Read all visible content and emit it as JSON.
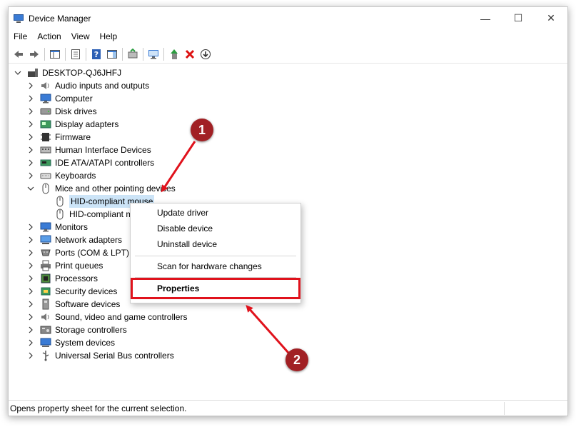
{
  "window": {
    "title": "Device Manager",
    "controls": {
      "minimize": "—",
      "maximize": "☐",
      "close": "✕"
    }
  },
  "menu": [
    "File",
    "Action",
    "View",
    "Help"
  ],
  "toolbar": [
    "back-icon",
    "forward-icon",
    "show-hide-console-tree-icon",
    "properties-icon",
    "help-icon",
    "action-pane-icon",
    "update-driver-icon",
    "scan-hardware-icon",
    "enable-device-icon",
    "uninstall-device-icon",
    "download-driver-icon"
  ],
  "tree": {
    "root": "DESKTOP-QJ6JHFJ",
    "categories": [
      {
        "label": "Audio inputs and outputs",
        "icon": "speaker-icon"
      },
      {
        "label": "Computer",
        "icon": "computer-icon"
      },
      {
        "label": "Disk drives",
        "icon": "disk-icon"
      },
      {
        "label": "Display adapters",
        "icon": "display-adapter-icon"
      },
      {
        "label": "Firmware",
        "icon": "firmware-icon"
      },
      {
        "label": "Human Interface Devices",
        "icon": "hid-icon"
      },
      {
        "label": "IDE ATA/ATAPI controllers",
        "icon": "ide-icon"
      },
      {
        "label": "Keyboards",
        "icon": "keyboard-icon"
      },
      {
        "label": "Mice and other pointing devices",
        "icon": "mouse-icon"
      }
    ],
    "mice_children": [
      "HID-compliant mouse",
      "HID-compliant m"
    ],
    "categories_after": [
      {
        "label": "Monitors",
        "icon": "monitor-icon"
      },
      {
        "label": "Network adapters",
        "icon": "network-icon"
      },
      {
        "label": "Ports (COM & LPT)",
        "icon": "port-icon"
      },
      {
        "label": "Print queues",
        "icon": "printer-icon"
      },
      {
        "label": "Processors",
        "icon": "processor-icon"
      },
      {
        "label": "Security devices",
        "icon": "security-icon"
      },
      {
        "label": "Software devices",
        "icon": "software-icon"
      },
      {
        "label": "Sound, video and game controllers",
        "icon": "sound-icon"
      },
      {
        "label": "Storage controllers",
        "icon": "storage-icon"
      },
      {
        "label": "System devices",
        "icon": "system-icon"
      },
      {
        "label": "Universal Serial Bus controllers",
        "icon": "usb-icon"
      }
    ]
  },
  "context_menu": {
    "update_driver": "Update driver",
    "disable_device": "Disable device",
    "uninstall_device": "Uninstall device",
    "scan": "Scan for hardware changes",
    "properties": "Properties"
  },
  "status": "Opens property sheet for the current selection.",
  "annotations": {
    "badge1": "1",
    "badge2": "2",
    "accent": "#e0121c",
    "badge_color": "#a12024"
  }
}
